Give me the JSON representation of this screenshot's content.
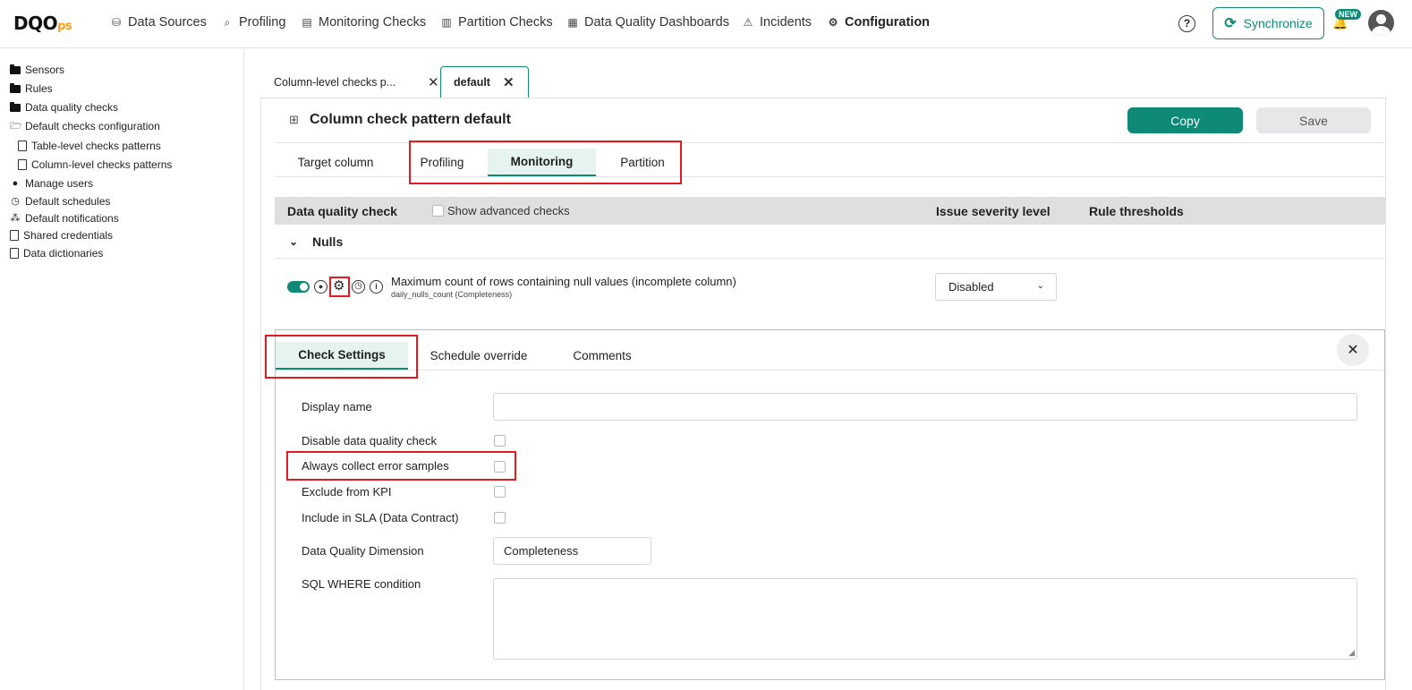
{
  "app": {
    "logo_main": "DQO",
    "logo_suffix": "ps"
  },
  "nav": {
    "items": [
      {
        "label": "Data Sources",
        "icon": "data-sources-icon"
      },
      {
        "label": "Profiling",
        "icon": "profiling-icon"
      },
      {
        "label": "Monitoring Checks",
        "icon": "monitoring-icon"
      },
      {
        "label": "Partition Checks",
        "icon": "partition-icon"
      },
      {
        "label": "Data Quality Dashboards",
        "icon": "dashboard-icon"
      },
      {
        "label": "Incidents",
        "icon": "warning-icon"
      },
      {
        "label": "Configuration",
        "icon": "gear-icon"
      }
    ],
    "help_symbol": "?",
    "sync_label": "Synchronize",
    "new_badge": "NEW"
  },
  "sidebar": {
    "items": [
      {
        "label": "Sensors"
      },
      {
        "label": "Rules"
      },
      {
        "label": "Data quality checks"
      },
      {
        "label": "Default checks configuration"
      },
      {
        "label": "Table-level checks patterns"
      },
      {
        "label": "Column-level checks patterns"
      },
      {
        "label": "Manage users"
      },
      {
        "label": "Default schedules"
      },
      {
        "label": "Default notifications"
      },
      {
        "label": "Shared credentials"
      },
      {
        "label": "Data dictionaries"
      }
    ]
  },
  "tabs": [
    {
      "label": "Column-level checks p...",
      "active": false
    },
    {
      "label": "default",
      "active": true
    }
  ],
  "page": {
    "title": "Column check pattern default",
    "copy_label": "Copy",
    "save_label": "Save"
  },
  "subtabs": [
    {
      "label": "Target column",
      "active": false
    },
    {
      "label": "Profiling",
      "active": false
    },
    {
      "label": "Monitoring",
      "active": true
    },
    {
      "label": "Partition",
      "active": false
    }
  ],
  "table": {
    "col_check": "Data quality check",
    "show_advanced": "Show advanced checks",
    "col_severity": "Issue severity level",
    "col_thresholds": "Rule thresholds",
    "group": "Nulls"
  },
  "check": {
    "name": "Maximum count of rows containing null values (incomplete column)",
    "sub": "daily_nulls_count (Completeness)",
    "severity": "Disabled",
    "enabled": true
  },
  "settings": {
    "tabs": [
      {
        "label": "Check Settings",
        "active": true
      },
      {
        "label": "Schedule override",
        "active": false
      },
      {
        "label": "Comments",
        "active": false
      }
    ],
    "close_symbol": "✕",
    "display_name_label": "Display name",
    "display_name_value": "",
    "disable_label": "Disable data quality check",
    "always_collect_label": "Always collect error samples",
    "exclude_kpi_label": "Exclude from KPI",
    "include_sla_label": "Include in SLA (Data Contract)",
    "dimension_label": "Data Quality Dimension",
    "dimension_value": "Completeness",
    "sql_where_label": "SQL WHERE condition",
    "sql_where_value": ""
  },
  "colors": {
    "accent": "#0e8a76",
    "highlight_box": "#e21b23",
    "tab_active_bg": "#e5f3f1"
  }
}
